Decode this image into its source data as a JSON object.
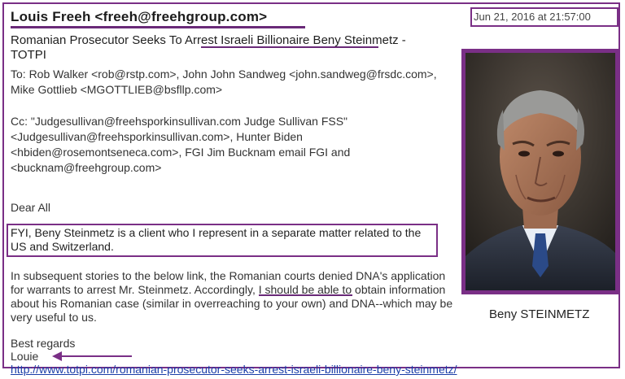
{
  "email": {
    "sender": "Louis Freeh <freeh@freehgroup.com>",
    "date": "Jun 21, 2016 at 21:57:00",
    "subject": "Romanian Prosecutor Seeks To Arrest Israeli Billionaire Beny Steinmetz - TOTPI",
    "to": "To: Rob Walker <rob@rstp.com>, John John Sandweg <john.sandweg@frsdc.com>, Mike Gottlieb <MGOTTLIEB@bsfllp.com>",
    "cc": "Cc: \"Judgesullivan@freehsporkinsullivan.com Judge Sullivan FSS\" <Judgesullivan@freehsporkinsullivan.com>, Hunter Biden <hbiden@rosemontseneca.com>, FGI Jim Bucknam email FGI and <bucknam@freehgroup.com>",
    "greeting": "Dear All",
    "fyi": "FYI, Beny Steinmetz is a client who I represent in a separate matter related to the US and Switzerland.",
    "body": "In subsequent stories to the below link, the Romanian courts denied DNA's application for warrants to arrest Mr. Steinmetz. Accordingly, I should be able to obtain information about his Romanian case (similar in overreaching to your own) and DNA--which may be very useful to us.",
    "regards": "Best regards",
    "signoff": "Louie",
    "link": "http://www.totpi.com/romanian-prosecutor-seeks-arrest-israeli-billionaire-beny-steinmetz/"
  },
  "photo": {
    "caption": "Beny STEINMETZ"
  },
  "colors": {
    "highlight": "#7a2f86",
    "link": "#1a3ea8"
  },
  "icons": [
    "left-arrow-annotation-icon"
  ]
}
